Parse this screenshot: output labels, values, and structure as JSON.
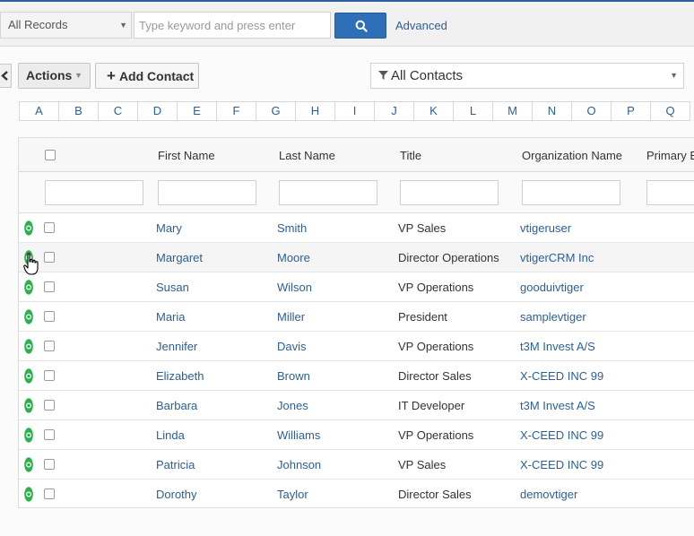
{
  "search": {
    "record_scope": "All Records",
    "keyword_placeholder": "Type keyword and press enter",
    "keyword_value": "",
    "advanced_label": "Advanced"
  },
  "toolbar": {
    "actions_label": "Actions",
    "add_label": "Add Contact",
    "filter_label": "All Contacts"
  },
  "alphabet": [
    "A",
    "B",
    "C",
    "D",
    "E",
    "F",
    "G",
    "H",
    "I",
    "J",
    "K",
    "L",
    "M",
    "N",
    "O",
    "P",
    "Q"
  ],
  "table": {
    "columns": [
      "First Name",
      "Last Name",
      "Title",
      "Organization Name",
      "Primary E"
    ],
    "rows": [
      {
        "first": "Mary",
        "last": "Smith",
        "title": "VP Sales",
        "org": "vtigeruser"
      },
      {
        "first": "Margaret",
        "last": "Moore",
        "title": "Director Operations",
        "org": "vtigerCRM Inc"
      },
      {
        "first": "Susan",
        "last": "Wilson",
        "title": "VP Operations",
        "org": "gooduivtiger"
      },
      {
        "first": "Maria",
        "last": "Miller",
        "title": "President",
        "org": "samplevtiger"
      },
      {
        "first": "Jennifer",
        "last": "Davis",
        "title": "VP Operations",
        "org": "t3M Invest A/S"
      },
      {
        "first": "Elizabeth",
        "last": "Brown",
        "title": "Director Sales",
        "org": "X-CEED INC 99"
      },
      {
        "first": "Barbara",
        "last": "Jones",
        "title": "IT Developer",
        "org": "t3M Invest A/S"
      },
      {
        "first": "Linda",
        "last": "Williams",
        "title": "VP Operations",
        "org": "X-CEED INC 99"
      },
      {
        "first": "Patricia",
        "last": "Johnson",
        "title": "VP Sales",
        "org": "X-CEED INC 99"
      },
      {
        "first": "Dorothy",
        "last": "Taylor",
        "title": "Director Sales",
        "org": "demovtiger"
      }
    ]
  },
  "icons": {
    "search_button": "search-icon",
    "back_button": "chevron-left-icon",
    "add_button": "plus-icon",
    "filter": "funnel-icon",
    "row_marker": "record-status-icon",
    "pointer": "hand-pointer-icon"
  },
  "colors": {
    "primary": "#2f6fb8",
    "link": "#2c5f96",
    "status_green": "#2bb24c"
  }
}
